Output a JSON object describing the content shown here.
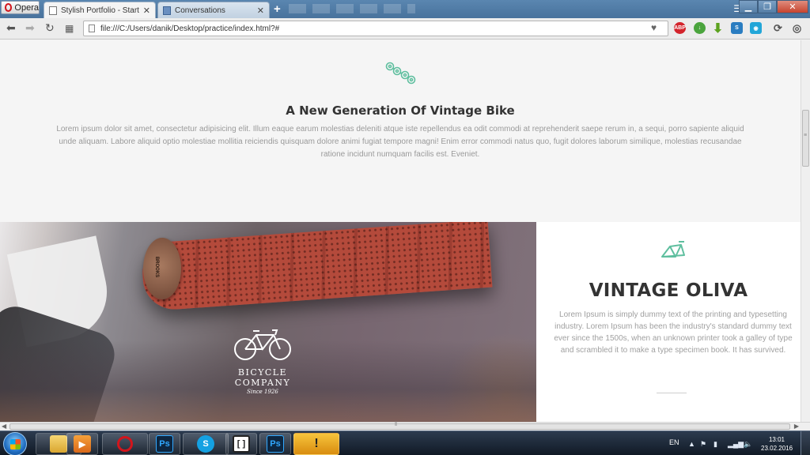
{
  "browser": {
    "menu_label": "Opera",
    "tabs": [
      {
        "label": "Stylish Portfolio - Start Bo",
        "close": "✕"
      },
      {
        "label": "Conversations",
        "close": "✕"
      }
    ],
    "new_tab": "+",
    "address": "file:///C:/Users/danik/Desktop/practice/index.html?#",
    "extensions": [
      "ABP"
    ]
  },
  "page": {
    "intro": {
      "title": "A New Generation Of Vintage Bike",
      "body": "Lorem ipsum dolor sit amet, consectetur adipisicing elit. Illum eaque earum molestias deleniti atque iste repellendus ea odit commodi at reprehenderit saepe rerum in, a sequi, porro sapiente aliquid unde aliquam. Labore aliquid optio molestiae mollitia reiciendis quisquam dolore animi fugiat tempore magni! Enim error commodi natus quo, fugit dolores laborum similique, molestias recusandae ratione incidunt numquam facilis est. Eveniet."
    },
    "hero": {
      "grip_brand": "BROOKS",
      "logo_line1": "BICYCLE",
      "logo_line2": "COMPANY",
      "logo_since": "Since 1926"
    },
    "feature": {
      "title": "VINTAGE OLIVA",
      "body": "Lorem Ipsum is simply dummy text of the printing and typesetting industry. Lorem Ipsum has been the industry's standard dummy text ever since the 1500s, when an unknown printer took a galley of type and scrambled it to make a type specimen book. It has survived."
    },
    "accent_color": "#5fbf9f"
  },
  "taskbar": {
    "language": "EN",
    "time": "13:01",
    "date": "23.02.2016",
    "apps": [
      {
        "name": "explorer",
        "label": ""
      },
      {
        "name": "media-player",
        "label": ""
      },
      {
        "name": "opera",
        "label": ""
      },
      {
        "name": "photoshop",
        "label": "Ps"
      },
      {
        "name": "skype",
        "label": "S"
      },
      {
        "name": "brackets",
        "label": ""
      },
      {
        "name": "photoshop-2",
        "label": "Ps"
      },
      {
        "name": "warning",
        "label": "!"
      }
    ]
  }
}
